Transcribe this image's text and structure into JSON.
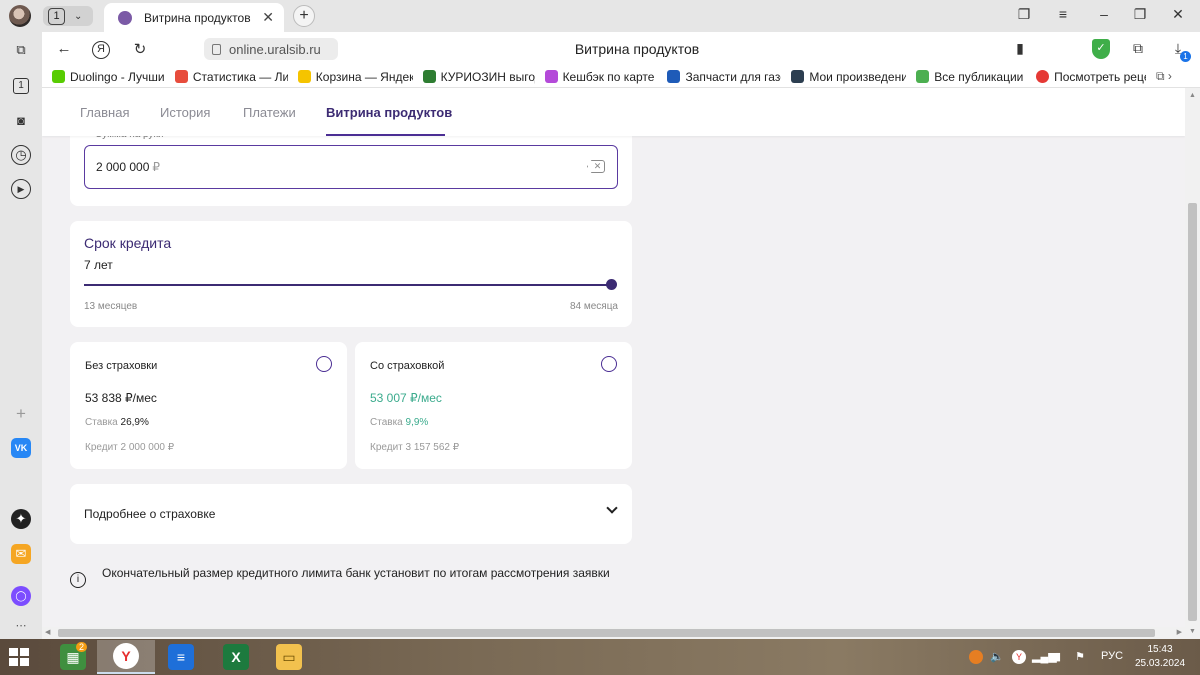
{
  "browser": {
    "tab_count": "1",
    "tab_title": "Витрина продуктов",
    "url": "online.uralsib.ru",
    "page_title": "Витрина продуктов",
    "shield_badge": "1",
    "bookmarks": [
      {
        "label": "Duolingo - Лучши",
        "icon": "duolingo-icon",
        "color": "#58cc02"
      },
      {
        "label": "Статистика — Лит",
        "icon": "stats-icon",
        "color": "#e74c3c"
      },
      {
        "label": "Корзина — Яндек",
        "icon": "market-icon",
        "color": "#f5c400"
      },
      {
        "label": "КУРИОЗИН выгод",
        "icon": "kuriozin-icon",
        "color": "#2e7d32"
      },
      {
        "label": "Кешбэк по карте",
        "icon": "cashback-icon",
        "color": "#b44ad9"
      },
      {
        "label": "Запчасти для газо",
        "icon": "parts-icon",
        "color": "#1e5bb8"
      },
      {
        "label": "Мои произведени",
        "icon": "works-icon",
        "color": "#2c3e50"
      },
      {
        "label": "Все публикации",
        "icon": "publications-icon",
        "color": "#4caf50"
      },
      {
        "label": "Посмотреть рецe",
        "icon": "recipe-icon",
        "color": "#e53935"
      }
    ]
  },
  "nav": {
    "items": [
      "Главная",
      "История",
      "Платежи",
      "Витрина продуктов"
    ],
    "active_index": 3
  },
  "amount": {
    "label": "Сумма на руки",
    "value": "2 000 000",
    "currency": "₽"
  },
  "term": {
    "title": "Срок кредита",
    "value": "7 лет",
    "min_label": "13 месяцев",
    "max_label": "84 месяца",
    "level_fraction": 1.0
  },
  "options": [
    {
      "title": "Без страховки",
      "payment": "53 838 ₽/мес",
      "rate_label": "Ставка",
      "rate": "26,9%",
      "credit": "Кредит 2 000 000 ₽",
      "highlight": false
    },
    {
      "title": "Со страховкой",
      "payment": "53 007 ₽/мес",
      "rate_label": "Ставка",
      "rate": "9,9%",
      "credit": "Кредит 3 157 562 ₽",
      "highlight": true
    }
  ],
  "insurance_more": "Подробнее о страховке",
  "info_text": "Окончательный размер кредитного лимита банк установит по итогам рассмотрения заявки",
  "taskbar": {
    "lang": "РУС",
    "time": "15:43",
    "date": "25.03.2024",
    "badge": "2"
  },
  "colors": {
    "accent": "#4b2e94",
    "accent_text": "#3c2b73",
    "green": "#3bab8d"
  }
}
